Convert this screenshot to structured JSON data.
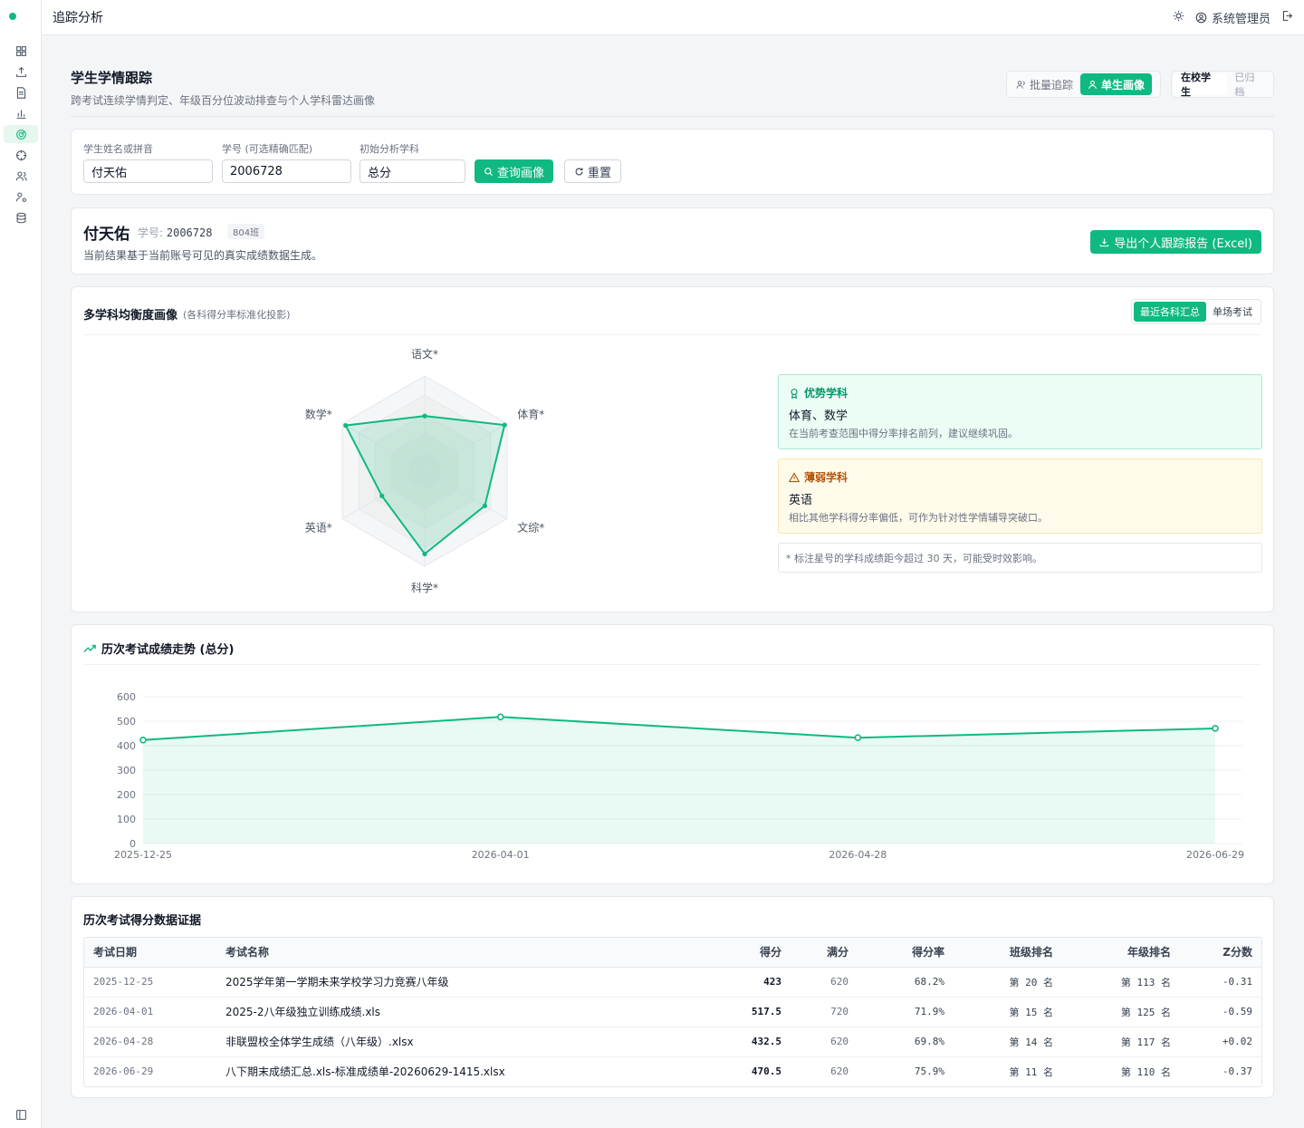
{
  "topbar": {
    "title": "追踪分析",
    "admin_label": "系统管理员"
  },
  "page": {
    "title": "学生学情跟踪",
    "subtitle": "跨考试连续学情判定、年级百分位波动排查与个人学科雷达画像",
    "mode_batch": "批量追踪",
    "mode_single": "单生画像",
    "scope_active": "在校学生",
    "scope_archived": "已归档"
  },
  "search": {
    "name_label": "学生姓名或拼音",
    "name_value": "付天佑",
    "id_label": "学号 (可选精确匹配)",
    "id_value": "2006728",
    "subject_label": "初始分析学科",
    "subject_value": "总分",
    "query_label": "查询画像",
    "reset_label": "重置"
  },
  "profile": {
    "name": "付天佑",
    "id_prefix": "学号:",
    "id": "2006728",
    "class": "804班",
    "note": "当前结果基于当前账号可见的真实成绩数据生成。",
    "export_label": "导出个人跟踪报告 (Excel)"
  },
  "radar": {
    "title": "多学科均衡度画像",
    "hint": "(各科得分率标准化投影)",
    "tab_recent": "最近各科汇总",
    "tab_single": "单场考试",
    "chart_data": {
      "type": "radar",
      "axes": [
        "语文*",
        "体育*",
        "文综*",
        "科学*",
        "英语*",
        "数学*"
      ],
      "values": [
        0.58,
        0.97,
        0.73,
        0.87,
        0.52,
        0.96
      ],
      "max": 1
    },
    "strong_title": "优势学科",
    "strong_value": "体育、数学",
    "strong_desc": "在当前考查范围中得分率排名前列，建议继续巩固。",
    "weak_title": "薄弱学科",
    "weak_value": "英语",
    "weak_desc": "相比其他学科得分率偏低，可作为针对性学情辅导突破口。",
    "footnote": "* 标注星号的学科成绩距今超过 30 天，可能受时效影响。"
  },
  "trend": {
    "title": "历次考试成绩走势 (总分)",
    "chart_data": {
      "type": "area",
      "x": [
        "2025-12-25",
        "2026-04-01",
        "2026-04-28",
        "2026-06-29"
      ],
      "values": [
        423,
        517.5,
        432.5,
        470.5
      ],
      "ylim": [
        0,
        600
      ],
      "yticks": [
        0,
        100,
        200,
        300,
        400,
        500,
        600
      ],
      "color": "#10b981"
    }
  },
  "table": {
    "title": "历次考试得分数据证据",
    "headers": [
      "考试日期",
      "考试名称",
      "得分",
      "满分",
      "得分率",
      "班级排名",
      "年级排名",
      "Z分数"
    ],
    "rows": [
      [
        "2025-12-25",
        "2025学年第一学期未来学校学习力竞赛八年级",
        "423",
        "620",
        "68.2%",
        "第 20 名",
        "第 113 名",
        "-0.31"
      ],
      [
        "2026-04-01",
        "2025-2八年级独立训练成绩.xls",
        "517.5",
        "720",
        "71.9%",
        "第 15 名",
        "第 125 名",
        "-0.59"
      ],
      [
        "2026-04-28",
        "非联盟校全体学生成绩（八年级）.xlsx",
        "432.5",
        "620",
        "69.8%",
        "第 14 名",
        "第 117 名",
        "+0.02"
      ],
      [
        "2026-06-29",
        "八下期末成绩汇总.xls-标准成绩单-20260629-1415.xlsx",
        "470.5",
        "620",
        "75.9%",
        "第 11 名",
        "第 110 名",
        "-0.37"
      ]
    ]
  },
  "colors": {
    "accent": "#10b981",
    "accent_light": "#ecfdf5",
    "warn": "#b45309"
  }
}
